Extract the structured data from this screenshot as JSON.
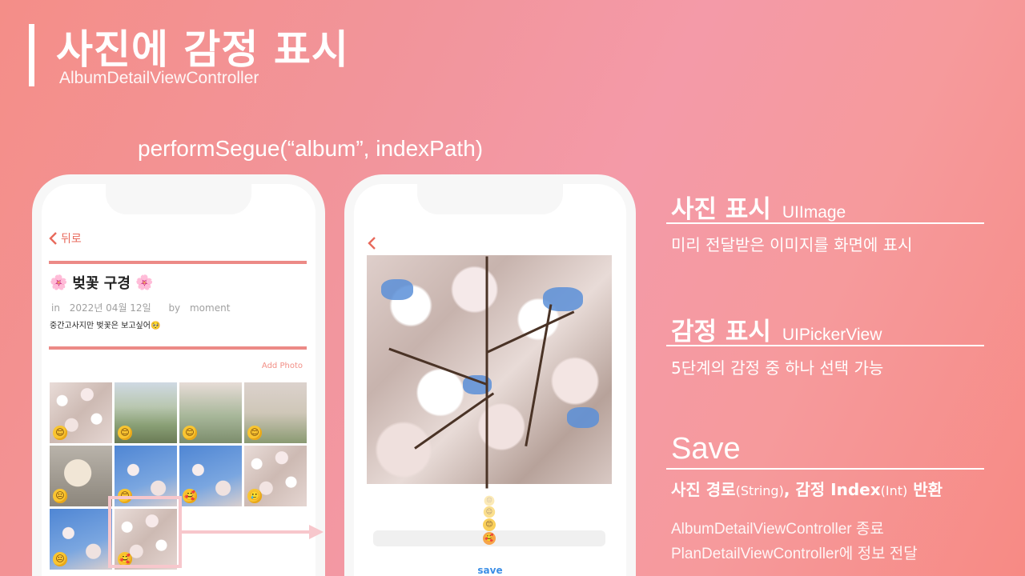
{
  "slide": {
    "title": "사진에 감정 표시",
    "subtitle": "AlbumDetailViewController",
    "segue": "performSegue(“album”, indexPath)"
  },
  "phone1": {
    "back_label": "뒤로",
    "album_title": "벚꽃 구경",
    "meta_in": "in",
    "meta_date": "2022년 04월 12일",
    "meta_by": "by",
    "meta_author": "moment",
    "description": "중간고사지만 벚꽃은 보고싶어🥺",
    "add_photo": "Add Photo",
    "grid_emotions": [
      "😊",
      "😊",
      "😊",
      "😊",
      "😐",
      "😊",
      "🥰",
      "🥲",
      "😐",
      "🥰"
    ]
  },
  "phone2": {
    "picker_emotions": [
      "😐",
      "😐",
      "😊",
      "🥰"
    ],
    "save_label": "save"
  },
  "sections": [
    {
      "heading": "사진 표시",
      "api": "UIImage",
      "desc": "미리 전달받은 이미지를 화면에 표시"
    },
    {
      "heading": "감정 표시",
      "api": "UIPickerView",
      "desc": "5단계의 감정 중 하나 선택 가능"
    }
  ],
  "save_section": {
    "heading": "Save",
    "desc_a": "사진 경로",
    "desc_a_type": "(String)",
    "desc_sep": ", ",
    "desc_b": "감정 Index",
    "desc_b_type": "(Int)",
    "desc_c": " 반환",
    "note1": "AlbumDetailViewController 종료",
    "note2": "PlanDetailViewController에 정보 전달"
  },
  "colors": {
    "accent": "#e86a5c",
    "save_blue": "#3b8ee6",
    "rule_pink": "#ec8a86"
  }
}
